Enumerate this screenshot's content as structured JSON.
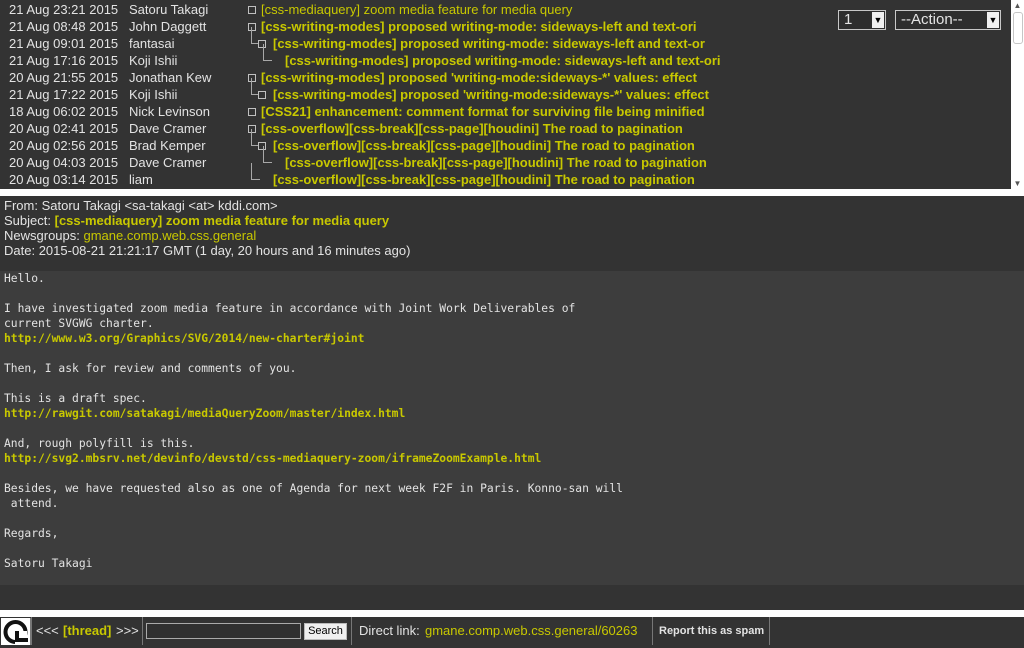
{
  "threads": [
    {
      "date": "21 Aug 23:21 2015",
      "author": "Satoru Takagi",
      "subject": "[css-mediaquery] zoom media feature for media query",
      "depth": 0,
      "current": true
    },
    {
      "date": "21 Aug 08:48 2015",
      "author": "John Daggett",
      "subject": "[css-writing-modes] proposed writing-mode: sideways-left and text-ori",
      "depth": 0,
      "current": false
    },
    {
      "date": "21 Aug 09:01 2015",
      "author": "fantasai",
      "subject": "[css-writing-modes] proposed writing-mode: sideways-left and text-or",
      "depth": 1,
      "current": false
    },
    {
      "date": "21 Aug 17:16 2015",
      "author": "Koji Ishii",
      "subject": "[css-writing-modes] proposed writing-mode: sideways-left and text-ori",
      "depth": 2,
      "current": false
    },
    {
      "date": "20 Aug 21:55 2015",
      "author": "Jonathan Kew",
      "subject": "[css-writing-modes] proposed 'writing-mode:sideways-*' values: effect",
      "depth": 0,
      "current": false
    },
    {
      "date": "21 Aug 17:22 2015",
      "author": "Koji Ishii",
      "subject": "[css-writing-modes] proposed 'writing-mode:sideways-*' values: effect",
      "depth": 1,
      "current": false
    },
    {
      "date": "18 Aug 06:02 2015",
      "author": "Nick Levinson",
      "subject": "[CSS21] enhancement: comment format for surviving file being minified",
      "depth": 0,
      "current": false
    },
    {
      "date": "20 Aug 02:41 2015",
      "author": "Dave Cramer",
      "subject": "[css-overflow][css-break][css-page][houdini] The road to pagination",
      "depth": 0,
      "current": false
    },
    {
      "date": "20 Aug 02:56 2015",
      "author": "Brad Kemper",
      "subject": "[css-overflow][css-break][css-page][houdini] The road to pagination",
      "depth": 1,
      "current": false
    },
    {
      "date": "20 Aug 04:03 2015",
      "author": "Dave Cramer",
      "subject": "[css-overflow][css-break][css-page][houdini] The road to pagination",
      "depth": 2,
      "current": false
    },
    {
      "date": "20 Aug 03:14 2015",
      "author": "liam",
      "subject": "[css-overflow][css-break][css-page][houdini] The road to pagination",
      "depth": 1,
      "current": false
    }
  ],
  "controls": {
    "page_value": "1",
    "action_value": "--Action--"
  },
  "message": {
    "from_label": "From:",
    "from_value": "Satoru Takagi <sa-takagi <at> kddi.com>",
    "subject_label": "Subject:",
    "subject_value": "[css-mediaquery] zoom media feature for media query",
    "newsgroups_label": "Newsgroups:",
    "newsgroups_value": "gmane.comp.web.css.general",
    "date_label": "Date:",
    "date_value": "2015-08-21 21:21:17 GMT (1 day, 20 hours and 16 minutes ago)",
    "body": [
      {
        "text": "Hello.",
        "url": false
      },
      {
        "text": "",
        "url": false
      },
      {
        "text": "I have investigated zoom media feature in accordance with Joint Work Deliverables of",
        "url": false
      },
      {
        "text": "current SVGWG charter.",
        "url": false
      },
      {
        "text": "http://www.w3.org/Graphics/SVG/2014/new-charter#joint",
        "url": true
      },
      {
        "text": "",
        "url": false
      },
      {
        "text": "Then, I ask for review and comments of you.",
        "url": false
      },
      {
        "text": "",
        "url": false
      },
      {
        "text": "This is a draft spec.",
        "url": false
      },
      {
        "text": "http://rawgit.com/satakagi/mediaQueryZoom/master/index.html",
        "url": true
      },
      {
        "text": "",
        "url": false
      },
      {
        "text": "And, rough polyfill is this.",
        "url": false
      },
      {
        "text": "http://svg2.mbsrv.net/devinfo/devstd/css-mediaquery-zoom/iframeZoomExample.html",
        "url": true
      },
      {
        "text": "",
        "url": false
      },
      {
        "text": "Besides, we have requested also as one of Agenda for next week F2F in Paris. Konno-san will",
        "url": false
      },
      {
        "text": " attend.",
        "url": false
      },
      {
        "text": "",
        "url": false
      },
      {
        "text": "Regards,",
        "url": false
      },
      {
        "text": "",
        "url": false
      },
      {
        "text": "Satoru Takagi",
        "url": false
      }
    ]
  },
  "footer": {
    "nav_prev": "<<<",
    "nav_thread": "[thread]",
    "nav_next": ">>>",
    "search_button": "Search",
    "direct_link_label": "Direct link:",
    "direct_link_value": "gmane.comp.web.css.general/60263",
    "spam_label": "Report this as spam"
  },
  "colors": {
    "background": "#333333",
    "link": "#c8c800",
    "body_background": "#3d3d3d",
    "border": "#ffffff"
  },
  "icons": {
    "logo": "gmane-logo-icon",
    "tree_node": "thread-node-box-icon",
    "scroll_up": "scroll-up-arrow-icon",
    "scroll_down": "scroll-down-arrow-icon",
    "dropdown": "dropdown-arrow-icon"
  }
}
